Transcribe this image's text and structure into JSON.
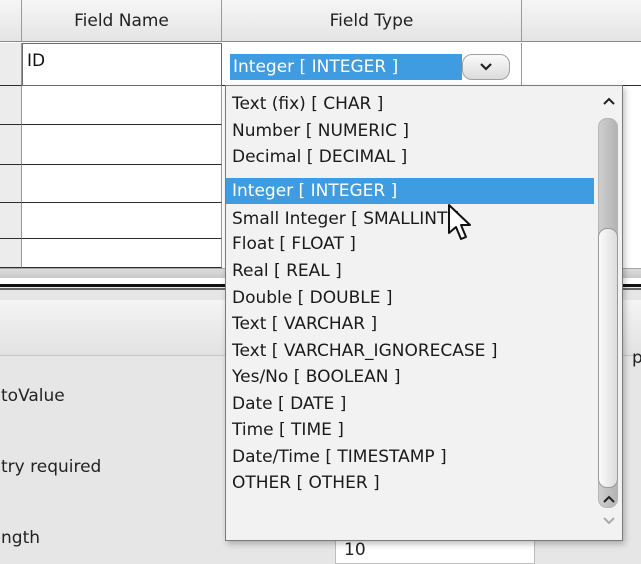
{
  "table": {
    "headers": {
      "field_name": "Field Name",
      "field_type": "Field Type"
    },
    "rows": [
      {
        "field_name": "ID",
        "field_type": "Integer [ INTEGER ]"
      },
      {
        "field_name": "",
        "field_type": ""
      },
      {
        "field_name": "",
        "field_type": ""
      },
      {
        "field_name": "",
        "field_type": ""
      },
      {
        "field_name": "",
        "field_type": ""
      },
      {
        "field_name": "",
        "field_type": ""
      }
    ]
  },
  "combo": {
    "value": "Integer [ INTEGER ]",
    "button_icon": "chevron-down-icon"
  },
  "dropdown": {
    "selected": "Integer [ INTEGER ]",
    "options": [
      "Text (fix) [ CHAR ]",
      "Number [ NUMERIC ]",
      "Decimal [ DECIMAL ]",
      "Integer [ INTEGER ]",
      "Small Integer [ SMALLINT ]",
      "Float [ FLOAT ]",
      "Real [ REAL ]",
      "Double [ DOUBLE ]",
      "Text [ VARCHAR ]",
      "Text [ VARCHAR_IGNORECASE ]",
      "Yes/No [ BOOLEAN ]",
      "Date [ DATE ]",
      "Time [ TIME ]",
      "Date/Time [ TIMESTAMP ]",
      "OTHER [ OTHER ]"
    ]
  },
  "properties": {
    "head_fragment": "p",
    "labels": [
      "toValue",
      "try required",
      "ngth"
    ],
    "length_value": "10"
  },
  "colors": {
    "selection": "#3f9ce0",
    "background": "#e6e6e6"
  }
}
